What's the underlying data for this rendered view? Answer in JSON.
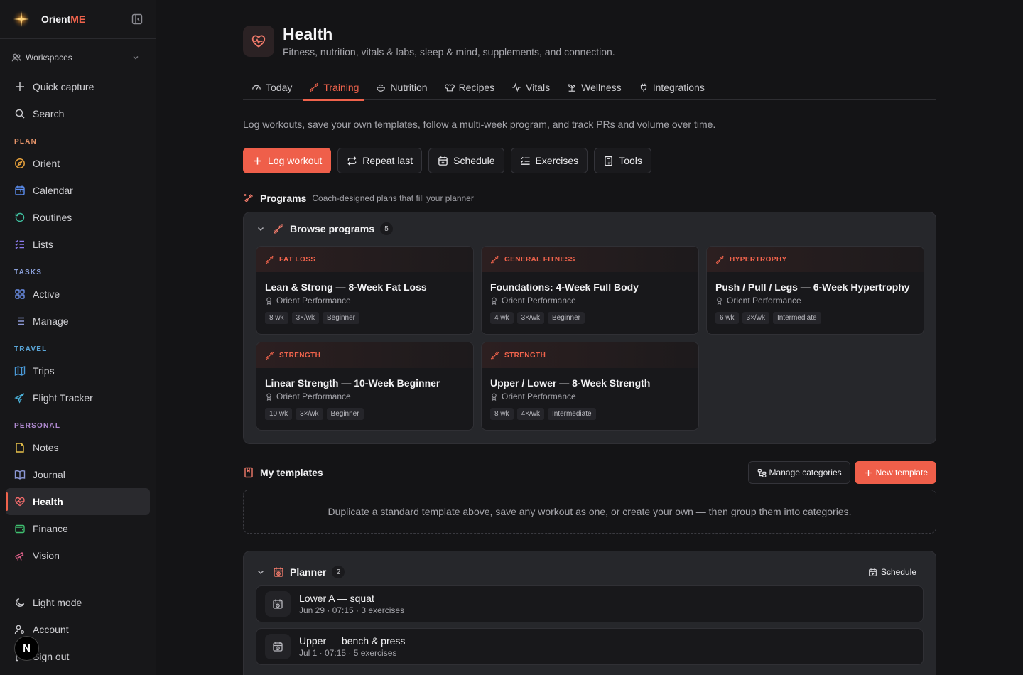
{
  "sidebar": {
    "brand_name": "Orient",
    "brand_accent": "ME",
    "workspaces_label": "Workspaces",
    "top_items": [
      {
        "label": "Quick capture",
        "icon": "plus-icon"
      },
      {
        "label": "Search",
        "icon": "search-icon"
      }
    ],
    "sections": [
      {
        "label": "PLAN",
        "color": "#e8956a",
        "items": [
          {
            "label": "Orient",
            "icon": "compass-icon",
            "color": "#e8a23c"
          },
          {
            "label": "Calendar",
            "icon": "calendar-icon",
            "color": "#5b8def"
          },
          {
            "label": "Routines",
            "icon": "refresh-icon",
            "color": "#3fbf9f"
          },
          {
            "label": "Lists",
            "icon": "checklist-icon",
            "color": "#8e7cf0"
          }
        ]
      },
      {
        "label": "TASKS",
        "color": "#8a9fd8",
        "items": [
          {
            "label": "Active",
            "icon": "grid-icon",
            "color": "#6b8fe8"
          },
          {
            "label": "Manage",
            "icon": "list-icon",
            "color": "#8e9ad8"
          }
        ]
      },
      {
        "label": "TRAVEL",
        "color": "#5aa6d8",
        "items": [
          {
            "label": "Trips",
            "icon": "map-icon",
            "color": "#4a9ad8"
          },
          {
            "label": "Flight Tracker",
            "icon": "plane-icon",
            "color": "#4ab0d8"
          }
        ]
      },
      {
        "label": "PERSONAL",
        "color": "#b08ad0",
        "items": [
          {
            "label": "Notes",
            "icon": "note-icon",
            "color": "#e8c24a"
          },
          {
            "label": "Journal",
            "icon": "book-icon",
            "color": "#8e9ad8"
          },
          {
            "label": "Health",
            "icon": "heart-pulse-icon",
            "color": "#f06a6a",
            "active": true
          },
          {
            "label": "Finance",
            "icon": "wallet-icon",
            "color": "#3fbf6f"
          },
          {
            "label": "Vision",
            "icon": "telescope-icon",
            "color": "#e0608a"
          }
        ]
      }
    ],
    "bottom_items": [
      {
        "label": "Light mode",
        "icon": "moon-icon"
      },
      {
        "label": "Account",
        "icon": "user-cog-icon"
      },
      {
        "label": "Sign out",
        "icon": "logout-icon"
      }
    ],
    "badge_letter": "N"
  },
  "header": {
    "title": "Health",
    "subtitle": "Fitness, nutrition, vitals & labs, sleep & mind, supplements, and connection."
  },
  "tabs": [
    {
      "label": "Today",
      "icon": "gauge-icon"
    },
    {
      "label": "Training",
      "icon": "dumbbell-icon",
      "active": true
    },
    {
      "label": "Nutrition",
      "icon": "bowl-icon"
    },
    {
      "label": "Recipes",
      "icon": "chef-hat-icon"
    },
    {
      "label": "Vitals",
      "icon": "activity-icon"
    },
    {
      "label": "Wellness",
      "icon": "sprout-icon"
    },
    {
      "label": "Integrations",
      "icon": "plug-icon"
    }
  ],
  "intro": "Log workouts, save your own templates, follow a multi-week program, and track PRs and volume over time.",
  "actions": [
    {
      "label": "Log workout",
      "icon": "plus-icon",
      "primary": true
    },
    {
      "label": "Repeat last",
      "icon": "repeat-icon"
    },
    {
      "label": "Schedule",
      "icon": "calendar-plus-icon"
    },
    {
      "label": "Exercises",
      "icon": "list-checks-icon"
    },
    {
      "label": "Tools",
      "icon": "calculator-icon"
    }
  ],
  "programs": {
    "title": "Programs",
    "subtitle": "Coach-designed plans that fill your planner",
    "panel_title": "Browse programs",
    "count": "5",
    "cards": [
      {
        "category": "FAT LOSS",
        "title": "Lean & Strong — 8-Week Fat Loss",
        "author": "Orient Performance",
        "chips": [
          "8 wk",
          "3×/wk",
          "Beginner"
        ]
      },
      {
        "category": "GENERAL FITNESS",
        "title": "Foundations: 4-Week Full Body",
        "author": "Orient Performance",
        "chips": [
          "4 wk",
          "3×/wk",
          "Beginner"
        ]
      },
      {
        "category": "HYPERTROPHY",
        "title": "Push / Pull / Legs — 6-Week Hypertrophy",
        "author": "Orient Performance",
        "chips": [
          "6 wk",
          "3×/wk",
          "Intermediate"
        ]
      },
      {
        "category": "STRENGTH",
        "title": "Linear Strength — 10-Week Beginner",
        "author": "Orient Performance",
        "chips": [
          "10 wk",
          "3×/wk",
          "Beginner"
        ]
      },
      {
        "category": "STRENGTH",
        "title": "Upper / Lower — 8-Week Strength",
        "author": "Orient Performance",
        "chips": [
          "8 wk",
          "4×/wk",
          "Intermediate"
        ]
      }
    ]
  },
  "templates": {
    "title": "My templates",
    "manage_label": "Manage categories",
    "new_label": "New template",
    "empty_text": "Duplicate a standard template above, save any workout as one, or create your own — then group them into categories."
  },
  "planner": {
    "title": "Planner",
    "count": "2",
    "schedule_label": "Schedule",
    "rows": [
      {
        "title": "Lower A — squat",
        "meta": "Jun 29 · 07:15 · 3 exercises"
      },
      {
        "title": "Upper — bench & press",
        "meta": "Jul 1 · 07:15 · 5 exercises"
      }
    ]
  },
  "colors": {
    "accent": "#ef5f4a",
    "background": "#141416",
    "sidebar": "#171719",
    "panel": "#26272b"
  }
}
